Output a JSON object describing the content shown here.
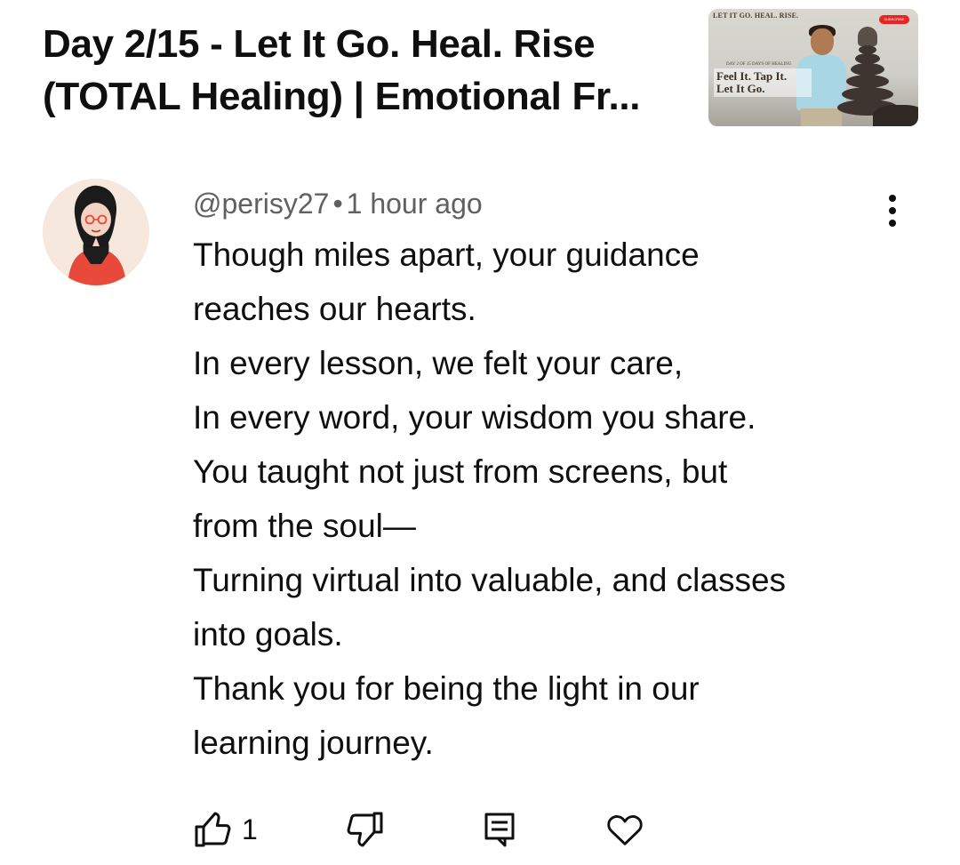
{
  "video": {
    "title_line1": "Day 2/15 - Let It Go. Heal. Rise",
    "title_line2": "(TOTAL Healing) | Emotional Fr...",
    "thumbnail": {
      "top_text": "LET IT GO. HEAL. RISE.",
      "day_text": "DAY 2 OF 15 DAYS OF HEALING",
      "overlay_line1": "Feel It. Tap It.",
      "overlay_line2": "Let It Go.",
      "badge": "SUBSCRIBE"
    }
  },
  "comment": {
    "author": "@perisy27",
    "separator": "•",
    "time": "1 hour ago",
    "lines": [
      "Though miles apart, your guidance",
      "reaches our hearts.",
      "In every lesson, we felt your care,",
      "In every word, your wisdom you share.",
      "You taught not just from screens, but",
      "from the soul—",
      "Turning virtual into valuable, and classes",
      "into goals.",
      "Thank you for being the light in our",
      "learning journey."
    ],
    "like_count": "1"
  },
  "colors": {
    "text": "#0f0f0f",
    "meta": "#606060",
    "background": "#ffffff"
  },
  "icons": [
    "more-vert-icon",
    "thumb-up-icon",
    "thumb-down-icon",
    "reply-icon",
    "heart-icon"
  ]
}
